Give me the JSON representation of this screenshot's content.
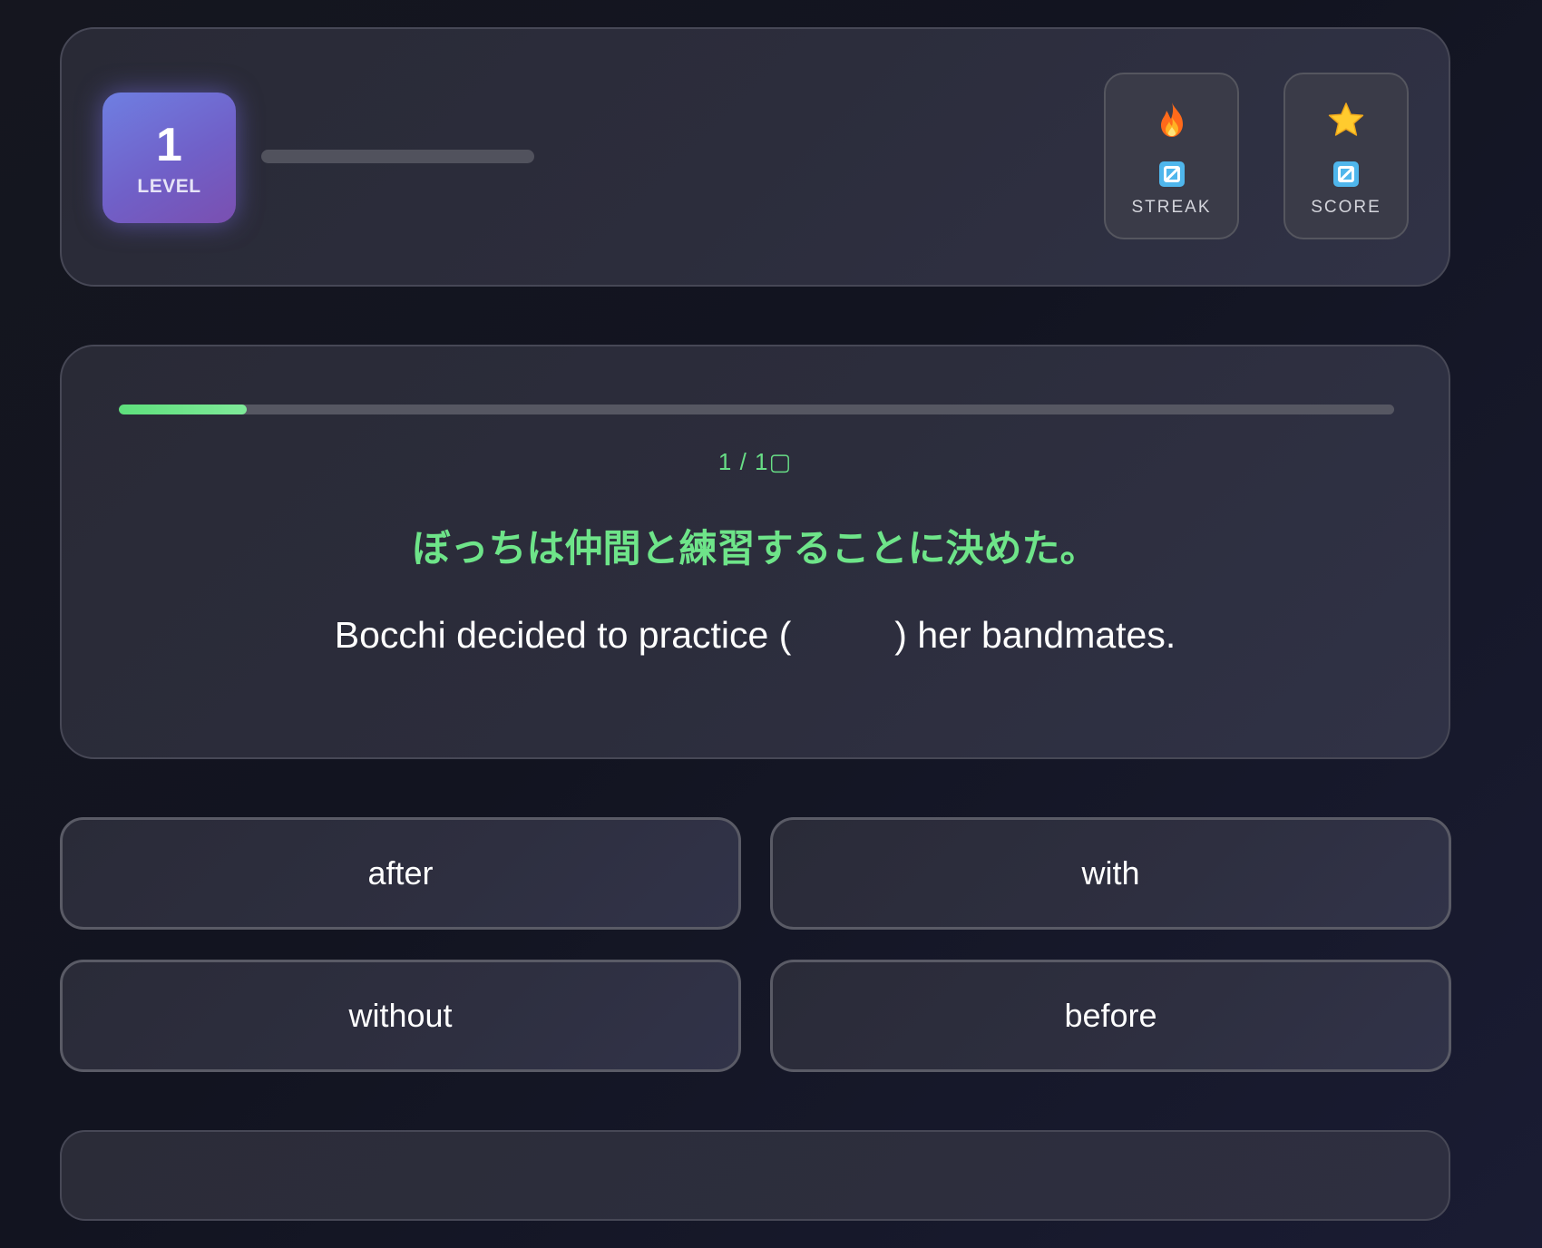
{
  "header": {
    "level": {
      "number": "1",
      "label": "LEVEL"
    },
    "xp_progress": 0,
    "stats": [
      {
        "icon": "fire-emoji-icon",
        "value_icon": "blank-value-icon",
        "label": "STREAK"
      },
      {
        "icon": "star-emoji-icon",
        "value_icon": "blank-value-icon",
        "label": "SCORE"
      }
    ]
  },
  "question": {
    "progress": 0.1,
    "counter": "1 / 1▢",
    "japanese": "ぼっちは仲間と練習することに決めた。",
    "english": "Bocchi decided to practice (          ) her bandmates."
  },
  "answers": [
    {
      "label": "after"
    },
    {
      "label": "with"
    },
    {
      "label": "without"
    },
    {
      "label": "before"
    }
  ],
  "feedback": {
    "text": ""
  },
  "colors": {
    "accent_green": "#6ee489",
    "level_badge": "#7163cc",
    "stat_value_blue": "#4fb6ec",
    "flame": "#ff6a1a",
    "star": "#ffcb2e"
  }
}
